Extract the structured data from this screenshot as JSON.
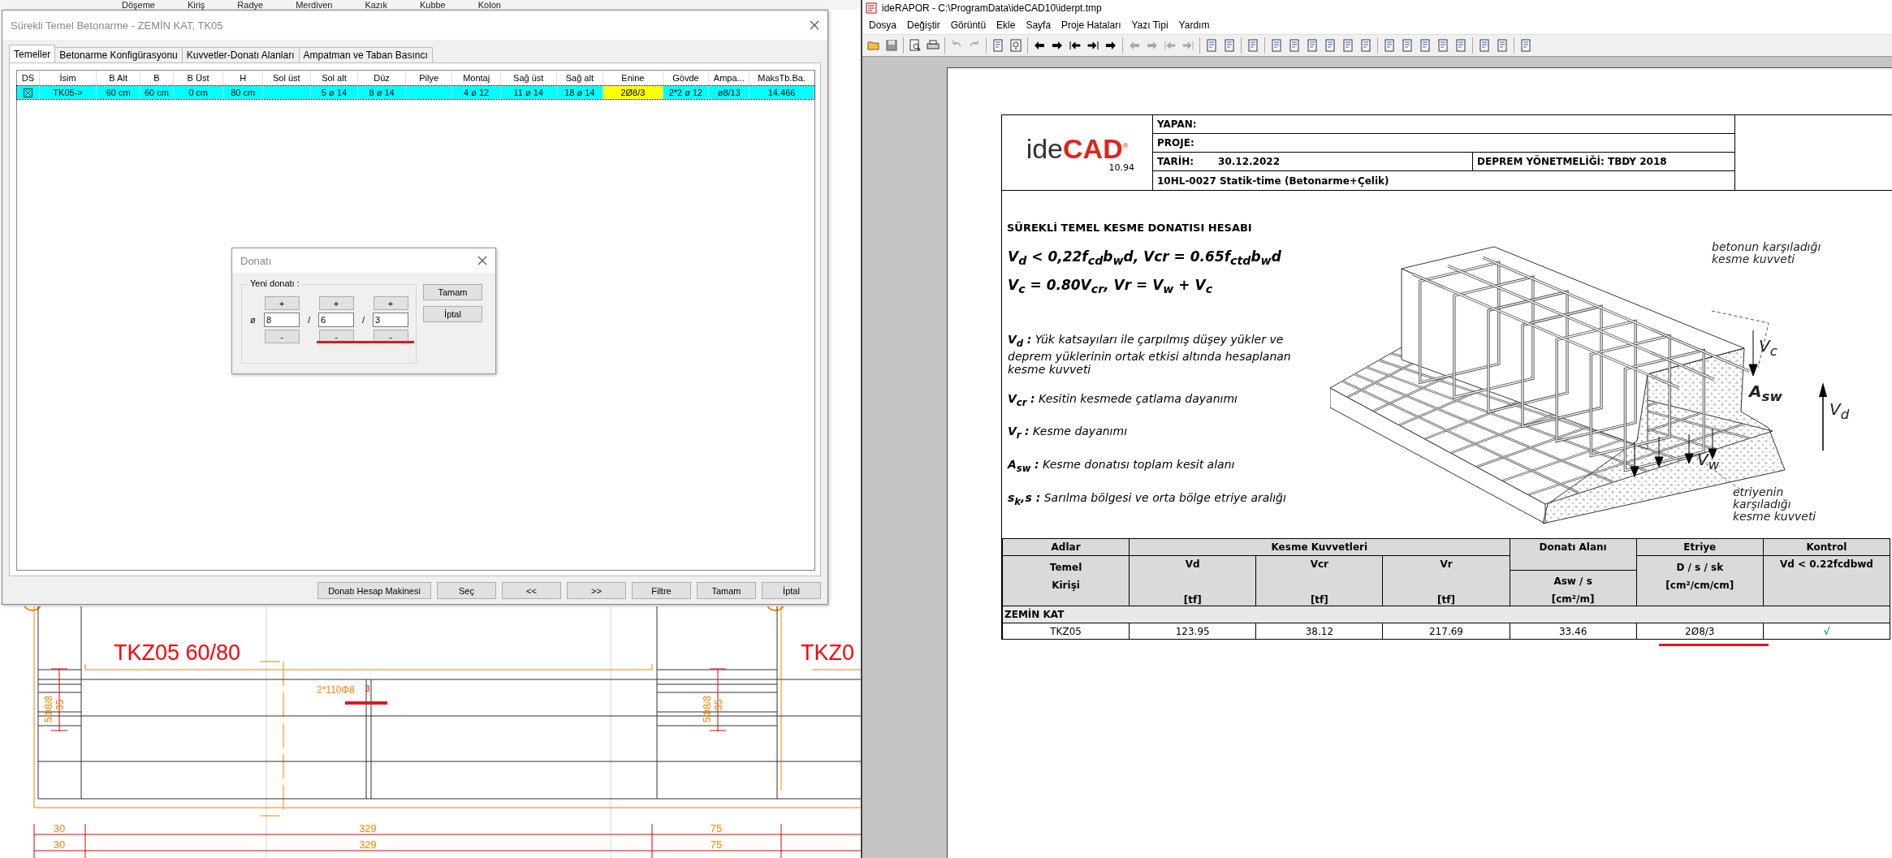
{
  "cad_window": {
    "top_labels": [
      "Döşeme",
      "Kiriş",
      "Radye",
      "Merdiven",
      "Kazık",
      "Kubbe",
      "Kolon"
    ]
  },
  "foundation_dialog": {
    "title": "Sürekli Temel Betonarme - ZEMİN KAT, TK05",
    "tabs": [
      {
        "label": "Temeller",
        "selected": true
      },
      {
        "label": "Betonarme Konfigürasyonu",
        "selected": false
      },
      {
        "label": "Kuvvetler-Donatı Alanları",
        "selected": false
      },
      {
        "label": "Ampatman ve Taban Basıncı",
        "selected": false
      }
    ],
    "table": {
      "columns": [
        "DS",
        "İsim",
        "B Alt",
        "B",
        "B Üst",
        "H",
        "Sol üst",
        "Sol alt",
        "Düz",
        "Pilye",
        "Montaj",
        "Sağ üst",
        "Sağ alt",
        "Enine",
        "Gövde",
        "Ampa...",
        "MaksTb.Ba."
      ],
      "rows": [
        {
          "selected": true,
          "cells": [
            {
              "checked": true,
              "highlighted": false
            },
            {
              "text": "TK05->",
              "highlighted": false
            },
            {
              "text": "60 cm",
              "highlighted": false
            },
            {
              "text": "60 cm",
              "highlighted": false
            },
            {
              "text": "0 cm",
              "highlighted": false
            },
            {
              "text": "80 cm",
              "highlighted": false
            },
            {
              "text": "",
              "highlighted": false
            },
            {
              "text": "5 ø 14",
              "highlighted": false
            },
            {
              "text": "8 ø 14",
              "highlighted": false
            },
            {
              "text": "",
              "highlighted": false
            },
            {
              "text": "4 ø 12",
              "highlighted": false
            },
            {
              "text": "11 ø 14",
              "highlighted": false
            },
            {
              "text": "18 ø 14",
              "highlighted": false
            },
            {
              "text": "2Ø8/3",
              "highlighted": true
            },
            {
              "text": "2*2 ø 12",
              "highlighted": false
            },
            {
              "text": "ø8/13",
              "highlighted": false
            },
            {
              "text": "14.466",
              "highlighted": false
            }
          ]
        }
      ]
    },
    "buttons": [
      "Donatı Hesap Makinesi",
      "Seç",
      "<<",
      ">>",
      "Filtre",
      "Tamam",
      "İptal"
    ]
  },
  "rebar_dialog": {
    "title": "Donatı",
    "group_label": "Yeni donatı :",
    "diameter_symbol": "ø",
    "fields": [
      {
        "value": "8",
        "plus": "+",
        "minus": "-"
      },
      {
        "value": "6",
        "plus": "+",
        "minus": "-"
      },
      {
        "value": "3",
        "plus": "+",
        "minus": "-"
      }
    ],
    "separators": [
      "/",
      "/"
    ],
    "buttons": [
      "Tamam",
      "İptal"
    ]
  },
  "cad_drawing": {
    "beam_label": "TKZ05 60/80",
    "next_beam_label": "TKZ0",
    "stirrup_label": "2*110Φ8",
    "stirrup_note": "3",
    "end_labels": [
      {
        "bars": "5Φ8/8",
        "length": "35"
      },
      {
        "bars": "5Φ8/8",
        "length": "35"
      }
    ],
    "dimension_rows": [
      [
        "30",
        "329",
        "75"
      ],
      [
        "30",
        "329",
        "75"
      ]
    ]
  },
  "report_window": {
    "title": "ideRAPOR - C:\\ProgramData\\ideCAD10\\iderpt.tmp",
    "menu": [
      "Dosya",
      "Değiştir",
      "Görüntü",
      "Ekle",
      "Sayfa",
      "Proje Hataları",
      "Yazı Tipi",
      "Yardım"
    ]
  },
  "report_page": {
    "logo": {
      "text_light": "ide",
      "text_bold": "CAD",
      "mark": "®",
      "version": "10.94"
    },
    "header": {
      "author_label": "YAPAN:",
      "project_label": "PROJE:",
      "date_label": "TARİH:",
      "date": "30.12.2022",
      "regulation": "DEPREM YÖNETMELİĞİ: TBDY 2018",
      "software": "10HL-0027 Statik-time (Betonarme+Çelik)"
    },
    "title": "SÜREKLİ TEMEL KESME DONATISI HESABI",
    "formulas": [
      "V$_{d}$ <  0,22f$_{cd}$b$_{w}$d, Vcr = 0.65f$_{ctd}$b$_{w}$d",
      "V$_{c}$ = 0.80V$_{cr}$, Vr =  V$_{w}$  + V$_{c}$"
    ],
    "definitions": [
      "**V**$_{d}$ **:** Yük katsayıları ile çarpılmış düşey yükler ve deprem yüklerinin ortak etkisi altında hesaplanan kesme kuvveti",
      "**V**$_{cr}$ **:** Kesitin kesmede çatlama dayanımı",
      "**V**$_{r}$ **:** Kesme dayanımı",
      "**A**$_{sw}$ **:** Kesme donatısı toplam kesit alanı",
      "**s**$_{k}$**,s :** Sarılma bölgesi ve orta bölge etriye aralığı"
    ],
    "figure_labels": {
      "concrete_resistance": "betonun karşıladığı kesme kuvveti",
      "vc": "V$_{c}$",
      "asw": "A$_{sw}$",
      "vd": "V$_{d}$",
      "vw": "V$_{w}$",
      "stirrup_resistance": "etriyenin karşıladığı kesme kuvveti"
    },
    "results_table": {
      "group_headers": [
        "Adlar",
        "Kesme Kuvvetleri",
        "Donatı Alanı",
        "Etriye",
        "Kontrol"
      ],
      "name_header": "Temel Kirişi",
      "force_columns": [
        {
          "name": "Vd",
          "unit": "[tf]"
        },
        {
          "name": "Vcr",
          "unit": "[tf]"
        },
        {
          "name": "Vr",
          "unit": "[tf]"
        }
      ],
      "area_header": "Asw / s",
      "area_unit": "[cm²/m]",
      "stirrup_header": "D / s / sk",
      "stirrup_unit": "[cm²/cm/cm]",
      "check_header": "Vd < 0.22fcdbwd",
      "sections": [
        {
          "name": "ZEMİN KAT",
          "rows": [
            {
              "name": "TKZ05",
              "vd": "123.95",
              "vcr": "38.12",
              "vr": "217.69",
              "asw": "33.46",
              "stirrup": "2Ø8/3",
              "check": "√",
              "passed": true
            }
          ]
        }
      ]
    }
  }
}
